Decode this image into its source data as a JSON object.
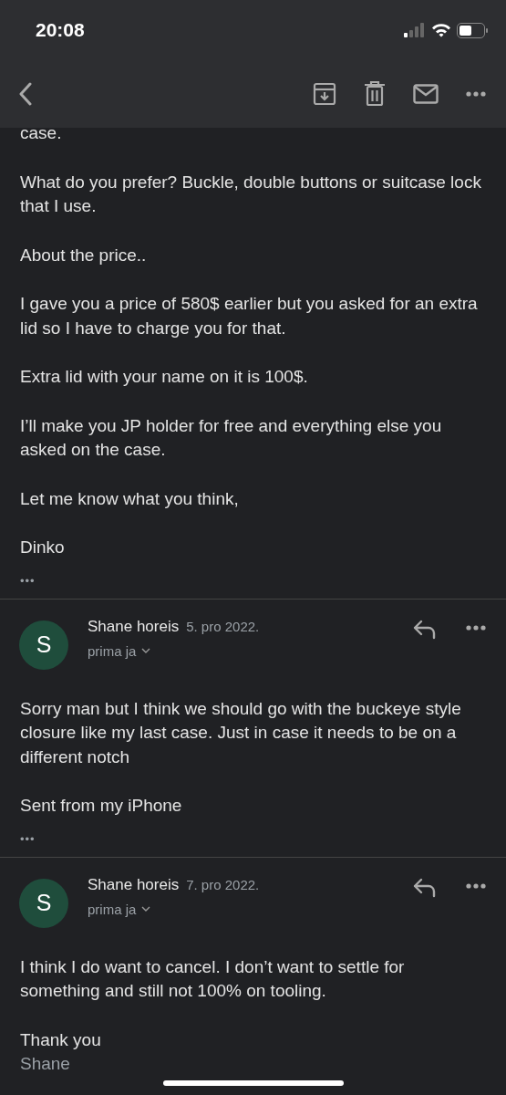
{
  "status_bar": {
    "time": "20:08"
  },
  "first_message": {
    "paragraphs": [
      {
        "kind": "text",
        "text": "case."
      },
      {
        "kind": "text",
        "text": "What do you prefer? Buckle, double buttons or suitcase lock that I use."
      },
      {
        "kind": "text",
        "text": "About the price.."
      },
      {
        "kind": "text",
        "text": "I gave you a price of 580$ earlier but you asked for an extra lid so I have to charge you for that."
      },
      {
        "kind": "text",
        "text": "Extra lid with your name on it is 100$."
      },
      {
        "kind": "text",
        "text": "I’ll make you JP holder for free and everything else you asked on the case."
      },
      {
        "kind": "text",
        "text": "Let me know what you think,"
      },
      {
        "kind": "text",
        "text": "Dinko"
      }
    ],
    "quote_toggle": "•••"
  },
  "messages": [
    {
      "avatar": "S",
      "color": "#1f4d3c",
      "sender": "Shane horeis",
      "date": "5. pro 2022.",
      "recipient": "prima ja",
      "paragraphs": [
        {
          "kind": "text",
          "text": "Sorry man but I think we should go with the buckeye style closure like my last case. Just in case it needs to be on a different notch"
        },
        {
          "kind": "text",
          "text": "Sent from my iPhone"
        }
      ],
      "quote_toggle": "•••"
    },
    {
      "avatar": "S",
      "color": "#1f4d3c",
      "sender": "Shane horeis",
      "date": "7. pro 2022.",
      "recipient": "prima ja",
      "paragraphs": [
        {
          "kind": "text",
          "text": "I think I do want to cancel. I don’t want to settle for something and still not 100% on tooling."
        },
        {
          "kind": "text",
          "text": "Thank you"
        },
        {
          "kind": "signature",
          "text": "Shane"
        }
      ]
    }
  ]
}
